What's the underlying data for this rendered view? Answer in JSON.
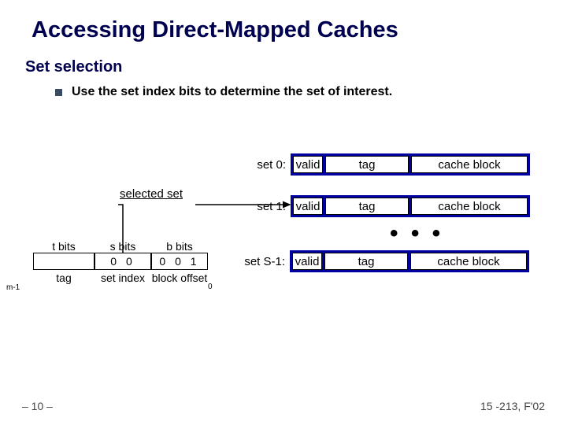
{
  "title": "Accessing Direct-Mapped Caches",
  "subtitle": "Set selection",
  "bullet": "Use the set index bits to determine the set of interest.",
  "sets": {
    "row0_label": "set 0:",
    "row1_label": "set 1:",
    "rowS_label": "set S-1:",
    "cells": {
      "valid": "valid",
      "tag": "tag",
      "block": "cache block"
    }
  },
  "dots": "• • •",
  "selected_label": "selected set",
  "addr": {
    "heads": {
      "t": "t bits",
      "s": "s bits",
      "b": "b bits"
    },
    "vals": {
      "t": "",
      "s": "0 0",
      "b": "0 0 1"
    },
    "labels": {
      "tag": "tag",
      "setidx": "set index",
      "blkoff": "block offset"
    },
    "m1": "m-1",
    "zero": "0"
  },
  "footer": {
    "left": "– 10 –",
    "right": "15 -213, F'02"
  }
}
